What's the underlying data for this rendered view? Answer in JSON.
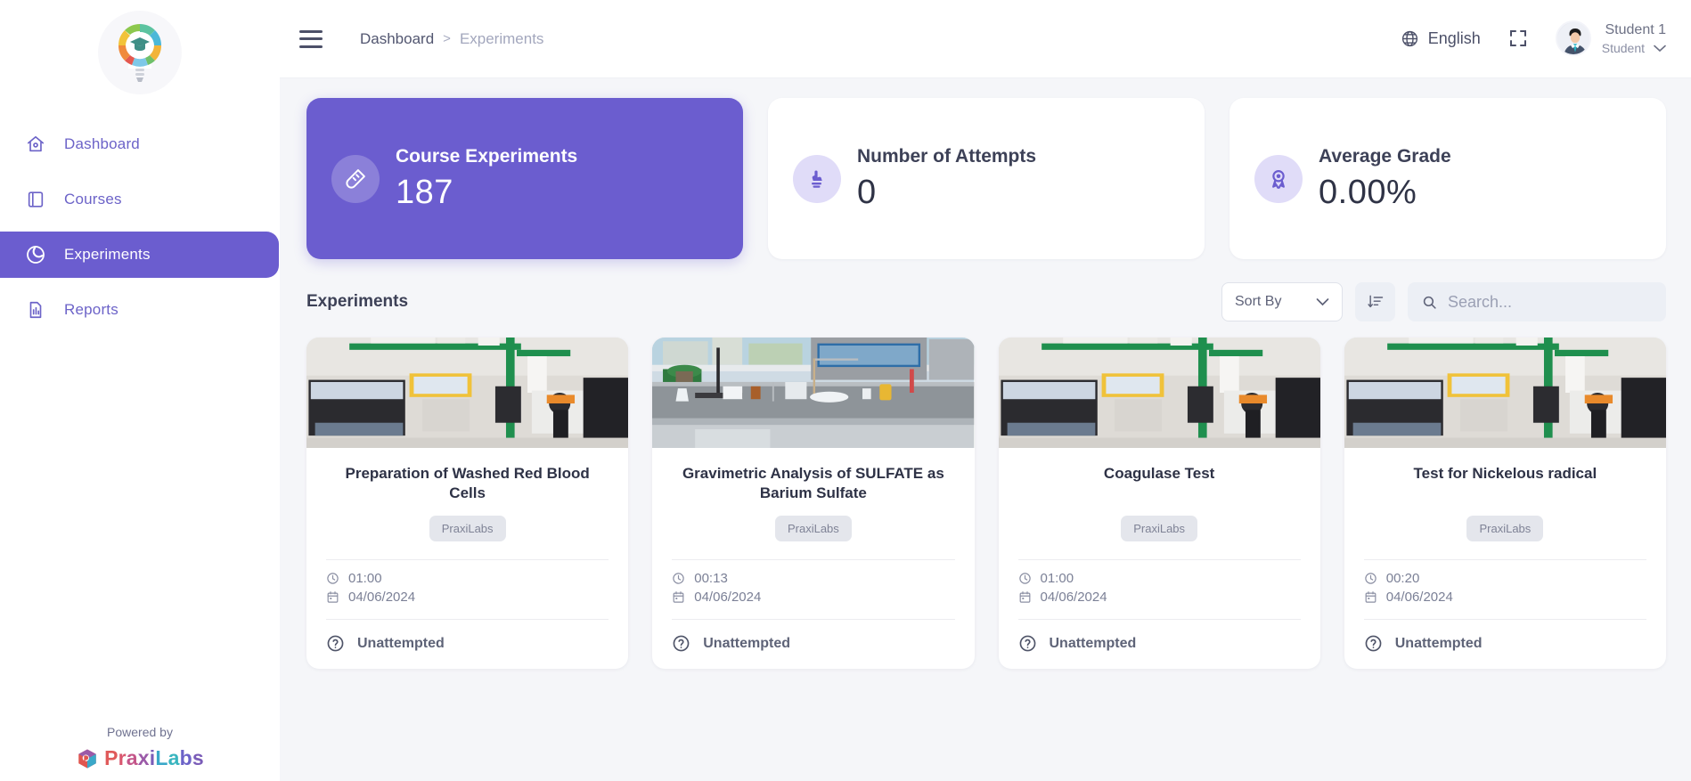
{
  "sidebar": {
    "logo_name": "praxilabs-bulb-logo",
    "items": [
      {
        "label": "Dashboard",
        "icon": "home-icon",
        "active": false
      },
      {
        "label": "Courses",
        "icon": "book-icon",
        "active": false
      },
      {
        "label": "Experiments",
        "icon": "experiment-icon",
        "active": true
      },
      {
        "label": "Reports",
        "icon": "report-icon",
        "active": false
      }
    ],
    "footer": {
      "powered_by": "Powered by",
      "brand_parts": [
        "P",
        "r",
        "a",
        "x",
        "i",
        "L",
        "a",
        "b",
        "s"
      ],
      "brand": "PraxiLabs"
    }
  },
  "topbar": {
    "menu_icon": "hamburger-icon",
    "breadcrumb": {
      "root": "Dashboard",
      "separator": ">",
      "current": "Experiments"
    },
    "language": {
      "label": "English",
      "icon": "globe-icon"
    },
    "fullscreen_icon": "fullscreen-icon",
    "user": {
      "name": "Student 1",
      "role": "Student",
      "chevron": "chevron-down-icon"
    }
  },
  "stats": [
    {
      "label": "Course Experiments",
      "value": "187",
      "icon": "test-tube-icon",
      "primary": true
    },
    {
      "label": "Number of Attempts",
      "value": "0",
      "icon": "click-hand-icon",
      "primary": false
    },
    {
      "label": "Average Grade",
      "value": "0.00%",
      "icon": "award-ribbon-icon",
      "primary": false
    }
  ],
  "list": {
    "title": "Experiments",
    "sort_label": "Sort By",
    "sort_dir_icon": "sort-descending-icon",
    "search_placeholder": "Search...",
    "search_value": "",
    "search_icon": "search-icon"
  },
  "experiments": [
    {
      "title": "Preparation of Washed Red Blood Cells",
      "tag": "PraxiLabs",
      "duration": "01:00",
      "date": "04/06/2024",
      "status": "Unattempted",
      "thumb": "lab-microscopes-photo"
    },
    {
      "title": "Gravimetric Analysis of SULFATE as Barium Sulfate",
      "tag": "PraxiLabs",
      "duration": "00:13",
      "date": "04/06/2024",
      "status": "Unattempted",
      "thumb": "virtual-lab-bench-photo"
    },
    {
      "title": "Coagulase Test",
      "tag": "PraxiLabs",
      "duration": "01:00",
      "date": "04/06/2024",
      "status": "Unattempted",
      "thumb": "lab-microscopes-photo"
    },
    {
      "title": "Test for Nickelous radical",
      "tag": "PraxiLabs",
      "duration": "00:20",
      "date": "04/06/2024",
      "status": "Unattempted",
      "thumb": "lab-microscopes-photo"
    }
  ],
  "colors": {
    "accent": "#6b5dcf",
    "accent_soft": "#e0dcf8",
    "content_bg": "#f5f6f9",
    "text_dark": "#2e3246",
    "text_muted": "#7b8096"
  }
}
